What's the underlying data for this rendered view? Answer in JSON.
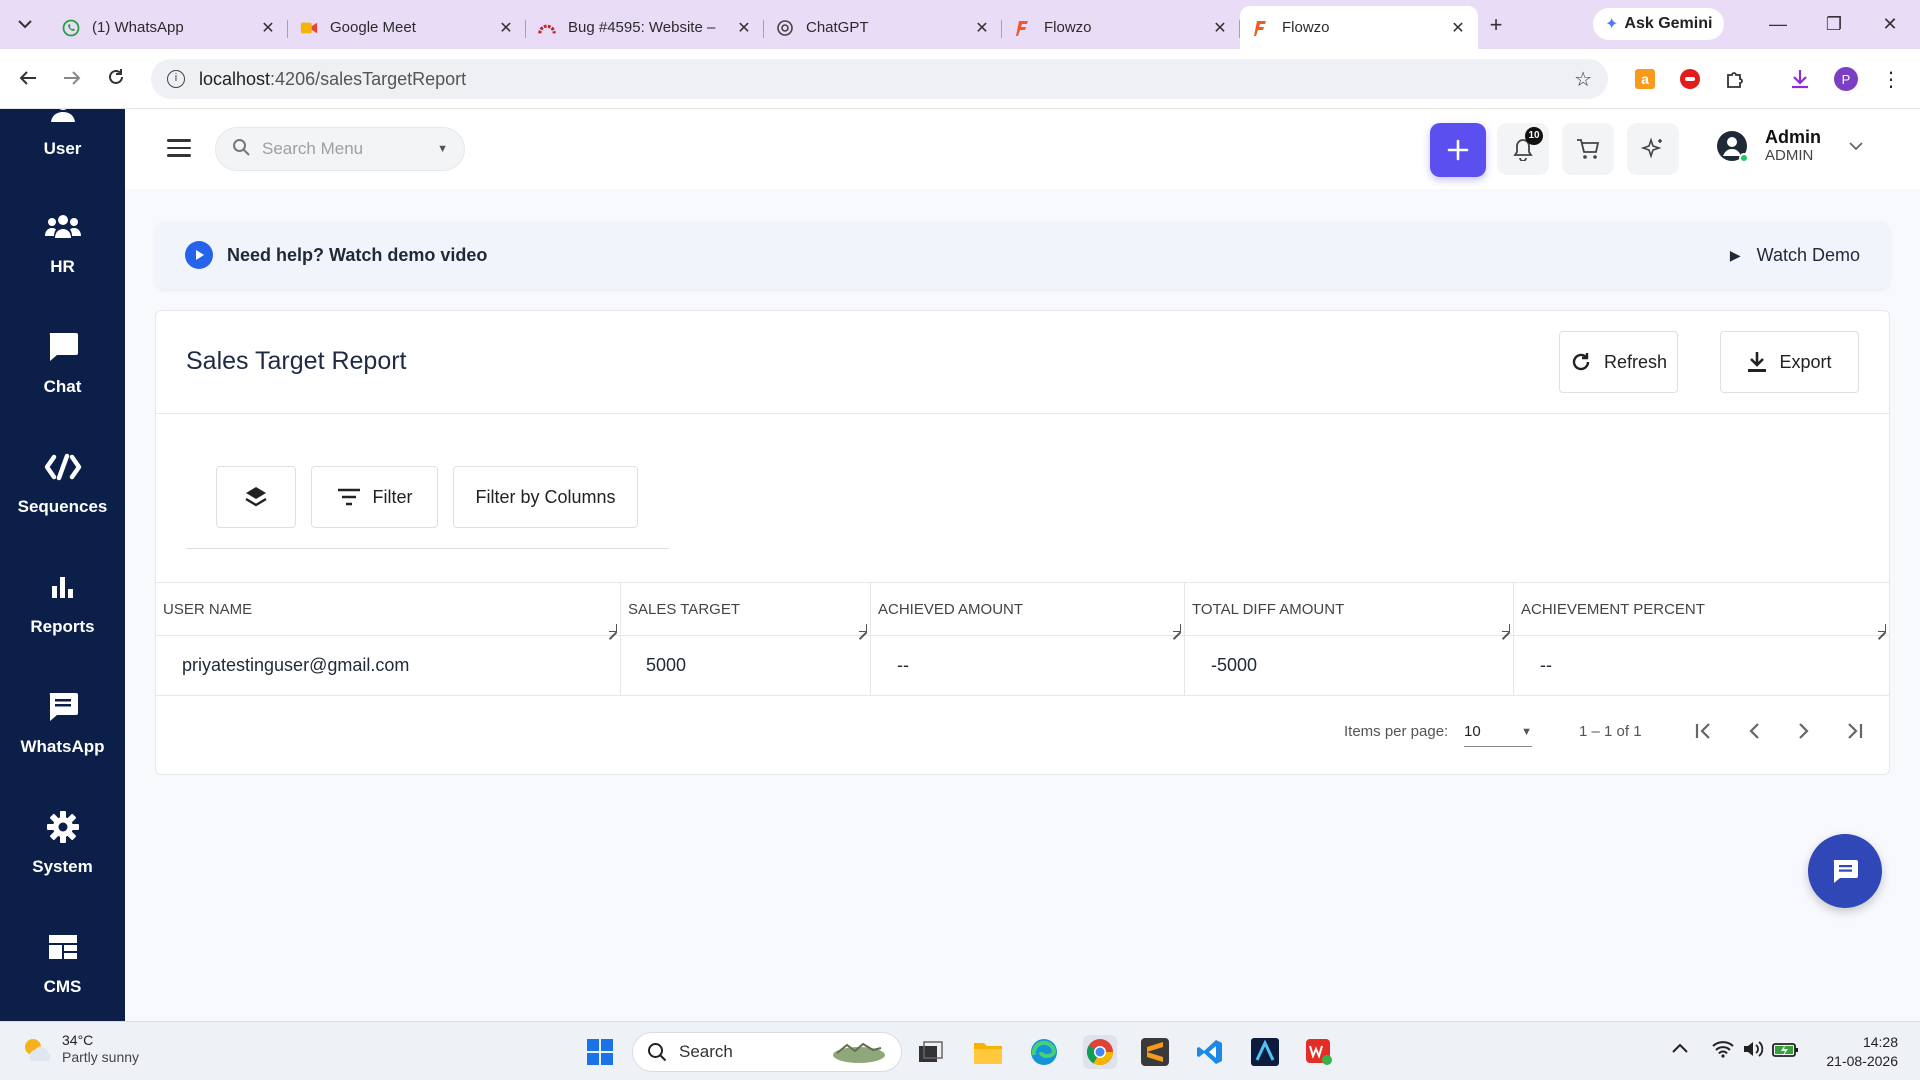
{
  "browser": {
    "tabs": [
      {
        "title": "(1) WhatsApp",
        "icon": "whatsapp-icon",
        "active": false
      },
      {
        "title": "Google Meet",
        "icon": "meet-icon",
        "active": false
      },
      {
        "title": "Bug #4595: Website –",
        "icon": "redmine-icon",
        "active": false
      },
      {
        "title": "ChatGPT",
        "icon": "chatgpt-icon",
        "active": false
      },
      {
        "title": "Flowzo",
        "icon": "flowzo-icon",
        "active": false
      },
      {
        "title": "Flowzo",
        "icon": "flowzo-icon",
        "active": true
      }
    ],
    "ask_gemini": "Ask Gemini",
    "url_host": "localhost",
    "url_path": ":4206/salesTargetReport",
    "profile_initial": "P"
  },
  "sidebar": {
    "items": [
      {
        "label": "User",
        "icon": "user-icon"
      },
      {
        "label": "HR",
        "icon": "team-icon"
      },
      {
        "label": "Chat",
        "icon": "chat-icon"
      },
      {
        "label": "Sequences",
        "icon": "sequences-icon"
      },
      {
        "label": "Reports",
        "icon": "bar-chart-icon"
      },
      {
        "label": "WhatsApp",
        "icon": "message-icon"
      },
      {
        "label": "System",
        "icon": "gear-icon"
      },
      {
        "label": "CMS",
        "icon": "dashboard-icon"
      }
    ]
  },
  "header": {
    "search_placeholder": "Search Menu",
    "notification_count": "10",
    "user_name": "Admin",
    "user_role": "ADMIN"
  },
  "help": {
    "text": "Need help? Watch demo video",
    "watch_label": "Watch Demo"
  },
  "report": {
    "title": "Sales Target Report",
    "refresh_label": "Refresh",
    "export_label": "Export",
    "filter_label": "Filter",
    "filter_columns_label": "Filter by Columns",
    "columns": [
      "USER NAME",
      "SALES TARGET",
      "ACHIEVED AMOUNT",
      "TOTAL DIFF AMOUNT",
      "ACHIEVEMENT PERCENT"
    ],
    "rows": [
      [
        "priyatestinguser@gmail.com",
        "5000",
        "--",
        "-5000",
        "--"
      ]
    ],
    "items_per_page_label": "Items per page:",
    "items_per_page": "10",
    "range_label": "1 – 1 of 1"
  },
  "taskbar": {
    "temperature": "34°C",
    "weather": "Partly sunny",
    "search_label": "Search",
    "time": "14:28",
    "date": "21-08-2026"
  },
  "colors": {
    "sidebar_bg": "#0b1f48",
    "accent": "#5b4ff0",
    "fab": "#2f47b7",
    "tab_strip": "#e9dcf7"
  }
}
